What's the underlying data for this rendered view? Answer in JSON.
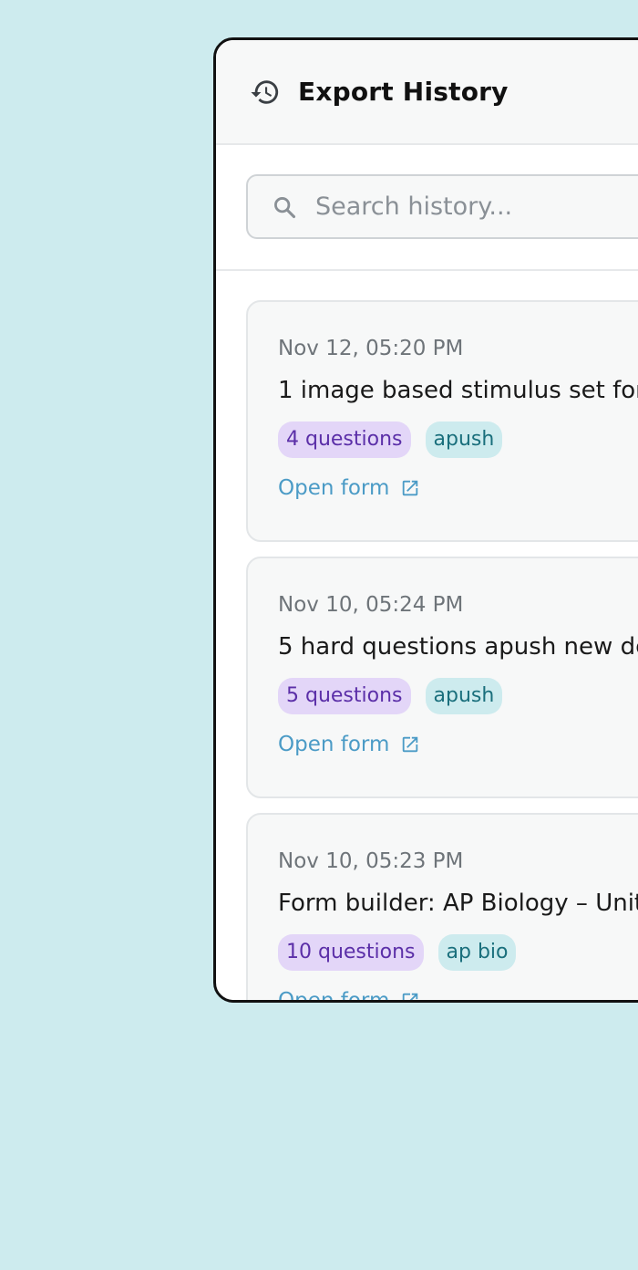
{
  "header": {
    "title": "Export History",
    "icon": "history-icon"
  },
  "search": {
    "placeholder": "Search history...",
    "value": "",
    "icon": "search-icon"
  },
  "colors": {
    "background": "#cdebee",
    "count_tag_bg": "#e3d6f8",
    "count_tag_text": "#5b2fa8",
    "topic_tag_bg": "#cdebee",
    "topic_tag_text": "#1a6f7c",
    "link": "#4b9bc6"
  },
  "entries": [
    {
      "date": "Nov 12, 05:20 PM",
      "name": "1 image based stimulus set for",
      "count_tag": "4 questions",
      "topic_tag": "apush",
      "open_label": "Open form"
    },
    {
      "date": "Nov 10, 05:24 PM",
      "name": "5 hard questions apush new de",
      "count_tag": "5 questions",
      "topic_tag": "apush",
      "open_label": "Open form"
    },
    {
      "date": "Nov 10, 05:23 PM",
      "name": "Form builder: AP Biology – Unit",
      "count_tag": "10 questions",
      "topic_tag": "ap bio",
      "open_label": "Open form"
    }
  ]
}
